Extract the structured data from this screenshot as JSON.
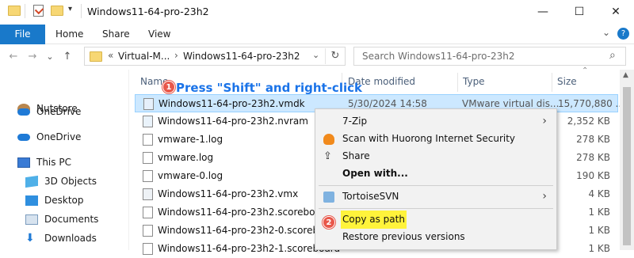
{
  "window": {
    "title": "Windows11-64-pro-23h2",
    "minimize_glyph": "—",
    "maximize_glyph": "☐",
    "close_glyph": "✕"
  },
  "ribbon": {
    "tabs": [
      "File",
      "Home",
      "Share",
      "View"
    ],
    "expand_glyph": "⌄",
    "help_glyph": "?"
  },
  "address": {
    "back": "←",
    "forward": "→",
    "recent": "⌄",
    "up": "↑",
    "overflow": "«",
    "crumbs": [
      "Virtual-M...",
      "Windows11-64-pro-23h2"
    ],
    "refresh": "↻",
    "search_placeholder": "Search Windows11-64-pro-23h2"
  },
  "nav": [
    {
      "label": "Nutstore",
      "icon": "nutstore-icon"
    },
    {
      "label": "OneDrive",
      "icon": "onedrive-icon"
    },
    {
      "label": "OneDrive",
      "icon": "onedrive-icon"
    },
    {
      "label": "This PC",
      "icon": "this-pc-icon"
    },
    {
      "label": "3D Objects",
      "icon": "3d-objects-icon"
    },
    {
      "label": "Desktop",
      "icon": "desktop-icon"
    },
    {
      "label": "Documents",
      "icon": "documents-icon"
    },
    {
      "label": "Downloads",
      "icon": "downloads-icon"
    }
  ],
  "columns": [
    "Name",
    "Date modified",
    "Type",
    "Size"
  ],
  "files": [
    {
      "name": "Windows11-64-pro-23h2.vmdk",
      "date": "5/30/2024 14:58",
      "type": "VMware virtual dis...",
      "size": "15,770,880 ..."
    },
    {
      "name": "Windows11-64-pro-23h2.nvram",
      "size": "2,352 KB"
    },
    {
      "name": "vmware-1.log",
      "size": "278 KB"
    },
    {
      "name": "vmware.log",
      "size": "278 KB"
    },
    {
      "name": "vmware-0.log",
      "size": "190 KB"
    },
    {
      "name": "Windows11-64-pro-23h2.vmx",
      "size": "4 KB"
    },
    {
      "name": "Windows11-64-pro-23h2.scoreboard",
      "size": "1 KB"
    },
    {
      "name": "Windows11-64-pro-23h2-0.scoreboard",
      "size": "1 KB"
    },
    {
      "name": "Windows11-64-pro-23h2-1.scoreboard",
      "size": "1 KB"
    }
  ],
  "context_menu": {
    "items": [
      {
        "label": "7-Zip",
        "has_submenu": true
      },
      {
        "label": "Scan with Huorong Internet Security",
        "icon": "huorong-icon"
      },
      {
        "label": "Share",
        "icon": "share-icon"
      },
      {
        "label": "Open with..."
      },
      {
        "label": "TortoiseSVN",
        "icon": "tortoisesvn-icon",
        "has_submenu": true
      },
      {
        "label": "Copy as path",
        "highlighted": true
      },
      {
        "label": "Restore previous versions"
      }
    ],
    "submenu_glyph": "›"
  },
  "annotations": {
    "step1_number": "1",
    "step1_text": "Press \"Shift\" and right-click",
    "step2_number": "2",
    "color": "#1a73e8",
    "highlight_color": "#fff33b"
  }
}
